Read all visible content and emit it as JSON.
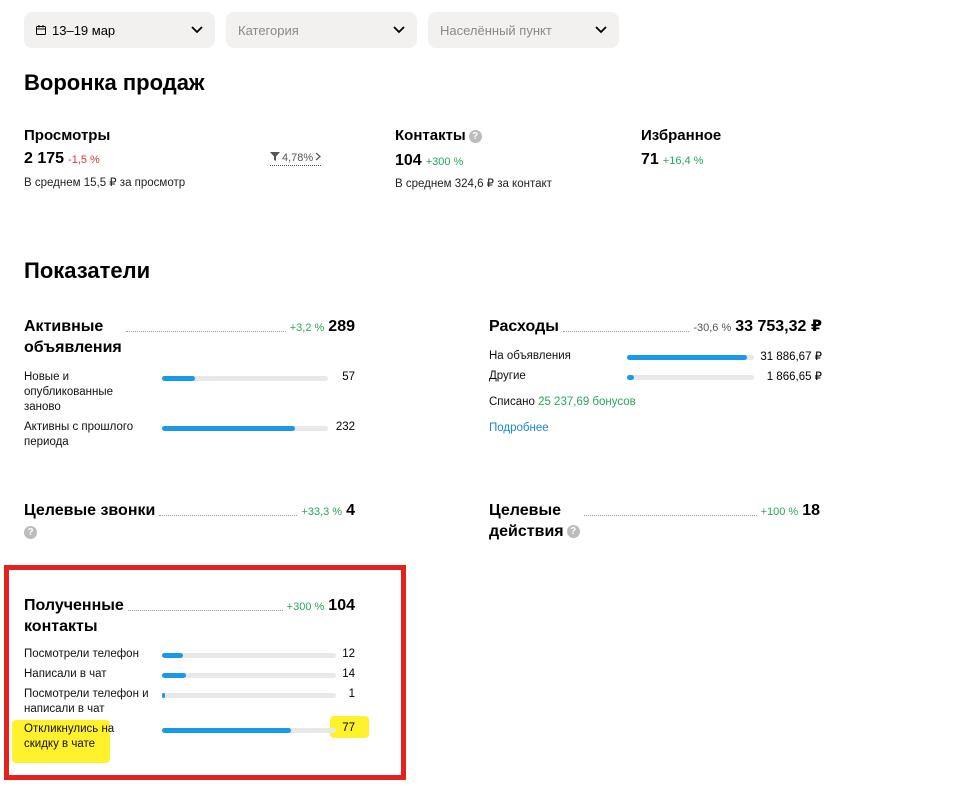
{
  "filters": {
    "date": "13–19 мар",
    "category_placeholder": "Категория",
    "location_placeholder": "Населённый пункт"
  },
  "funnel": {
    "title": "Воронка продаж",
    "views": {
      "label": "Просмотры",
      "value": "2 175",
      "delta": "-1,5 %",
      "sub": "В среднем 15,5 ₽ за просмотр"
    },
    "conversion": "4,78%",
    "contacts": {
      "label": "Контакты",
      "value": "104",
      "delta": "+300 %",
      "sub": "В среднем 324,6 ₽ за контакт"
    },
    "favorites": {
      "label": "Избранное",
      "value": "71",
      "delta": "+16,4 %"
    }
  },
  "indicators": {
    "title": "Показатели",
    "active_ads": {
      "title_line1": "Активные",
      "title_line2": "объявления",
      "delta": "+3,2 %",
      "value": "289",
      "rows": [
        {
          "label": "Новые и опубликованные заново",
          "value": "57",
          "fill": 0.2
        },
        {
          "label": "Активны с прошлого периода",
          "value": "232",
          "fill": 0.8
        }
      ]
    },
    "expenses": {
      "title": "Расходы",
      "delta": "-30,6 %",
      "value": "33 753,32 ₽",
      "rows": [
        {
          "label": "На объявления",
          "value": "31 886,67 ₽",
          "fill": 0.945
        },
        {
          "label": "Другие",
          "value": "1 866,65 ₽",
          "fill": 0.055
        }
      ],
      "written_off_label": "Списано",
      "written_off_value": "25 237,69 бонусов",
      "more_link": "Подробнее"
    },
    "target_calls": {
      "title": "Целевые звонки",
      "delta": "+33,3 %",
      "value": "4"
    },
    "target_actions": {
      "title_line1": "Целевые",
      "title_line2": "действия",
      "delta": "+100 %",
      "value": "18"
    },
    "received_contacts": {
      "title_line1": "Полученные",
      "title_line2": "контакты",
      "delta": "+300 %",
      "value": "104",
      "rows": [
        {
          "label": "Посмотрели телефон",
          "value": "12",
          "fill": 0.12
        },
        {
          "label": "Написали в чат",
          "value": "14",
          "fill": 0.14
        },
        {
          "label": "Посмотрели телефон и написали в чат",
          "value": "1",
          "fill": 0.02
        },
        {
          "label": "Откликнулись на скидку в чате",
          "value": "77",
          "fill": 0.74
        }
      ]
    }
  },
  "colors": {
    "accent": "#1b99e8",
    "positive": "#2aa856",
    "negative": "#e0342f",
    "annotation_box": "#e3221f",
    "highlight": "#fff22d"
  }
}
